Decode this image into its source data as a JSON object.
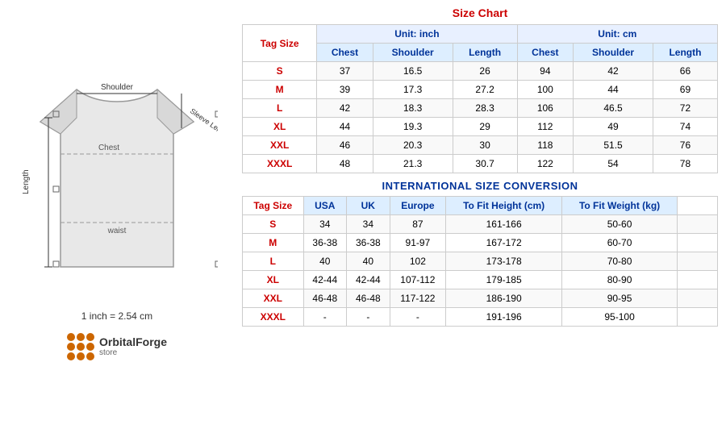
{
  "left": {
    "diagram_labels": {
      "shoulder": "Shoulder",
      "sleeve": "Sleeve Length",
      "chest": "Chest",
      "length": "Length",
      "waist": "waist"
    },
    "note": "1 inch = 2.54 cm",
    "logo_name": "OrbitalForge",
    "logo_store": "store"
  },
  "size_chart": {
    "title": "Size Chart",
    "inch_unit": "Unit: inch",
    "cm_unit": "Unit: cm",
    "tag_size_label": "Tag Size",
    "headers_inch": [
      "Chest",
      "Shoulder",
      "Length"
    ],
    "headers_cm": [
      "Chest",
      "Shoulder",
      "Length"
    ],
    "rows": [
      {
        "tag": "S",
        "chest_in": "37",
        "shoulder_in": "16.5",
        "length_in": "26",
        "chest_cm": "94",
        "shoulder_cm": "42",
        "length_cm": "66"
      },
      {
        "tag": "M",
        "chest_in": "39",
        "shoulder_in": "17.3",
        "length_in": "27.2",
        "chest_cm": "100",
        "shoulder_cm": "44",
        "length_cm": "69"
      },
      {
        "tag": "L",
        "chest_in": "42",
        "shoulder_in": "18.3",
        "length_in": "28.3",
        "chest_cm": "106",
        "shoulder_cm": "46.5",
        "length_cm": "72"
      },
      {
        "tag": "XL",
        "chest_in": "44",
        "shoulder_in": "19.3",
        "length_in": "29",
        "chest_cm": "112",
        "shoulder_cm": "49",
        "length_cm": "74"
      },
      {
        "tag": "XXL",
        "chest_in": "46",
        "shoulder_in": "20.3",
        "length_in": "30",
        "chest_cm": "118",
        "shoulder_cm": "51.5",
        "length_cm": "76"
      },
      {
        "tag": "XXXL",
        "chest_in": "48",
        "shoulder_in": "21.3",
        "length_in": "30.7",
        "chest_cm": "122",
        "shoulder_cm": "54",
        "length_cm": "78"
      }
    ]
  },
  "conversion": {
    "title": "INTERNATIONAL SIZE CONVERSION",
    "tag_size_label": "Tag Size",
    "headers": [
      "USA",
      "UK",
      "Europe",
      "To Fit Height (cm)",
      "To Fit Weight (kg)"
    ],
    "rows": [
      {
        "tag": "S",
        "usa": "34",
        "uk": "34",
        "europe": "87",
        "height": "161-166",
        "weight": "50-60"
      },
      {
        "tag": "M",
        "usa": "36-38",
        "uk": "36-38",
        "europe": "91-97",
        "height": "167-172",
        "weight": "60-70"
      },
      {
        "tag": "L",
        "usa": "40",
        "uk": "40",
        "europe": "102",
        "height": "173-178",
        "weight": "70-80"
      },
      {
        "tag": "XL",
        "usa": "42-44",
        "uk": "42-44",
        "europe": "107-112",
        "height": "179-185",
        "weight": "80-90"
      },
      {
        "tag": "XXL",
        "usa": "46-48",
        "uk": "46-48",
        "europe": "117-122",
        "height": "186-190",
        "weight": "90-95"
      },
      {
        "tag": "XXXL",
        "usa": "-",
        "uk": "-",
        "europe": "-",
        "height": "191-196",
        "weight": "95-100"
      }
    ]
  }
}
